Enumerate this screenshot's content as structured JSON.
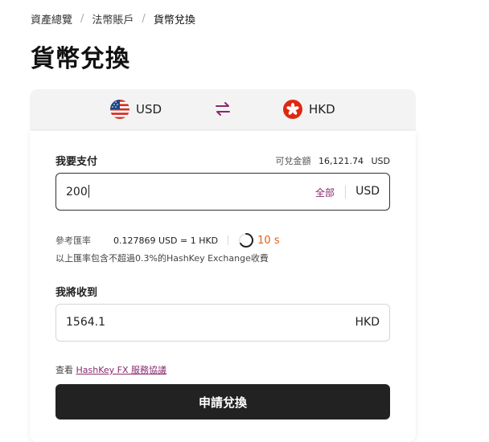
{
  "breadcrumb": {
    "items": [
      "資產總覽",
      "法幣賬戶",
      "貨幣兌換"
    ],
    "separator": "/"
  },
  "page": {
    "title": "貨幣兌換"
  },
  "currency_bar": {
    "from": {
      "code": "USD",
      "flag_icon": "us-flag-icon"
    },
    "to": {
      "code": "HKD",
      "flag_icon": "hk-flag-icon"
    },
    "swap_icon": "swap-arrows-icon"
  },
  "pay": {
    "label": "我要支付",
    "available_label": "可兌金額",
    "available_amount": "16,121.74",
    "available_currency": "USD",
    "value": "200",
    "all_label": "全部",
    "currency": "USD"
  },
  "rate": {
    "label": "參考匯率",
    "value": "0.127869  USD = 1 HKD",
    "countdown": "10 s",
    "note": "以上匯率包含不超過0.3%的HashKey Exchange收費"
  },
  "receive": {
    "label": "我將收到",
    "value": "1564.1",
    "currency": "HKD"
  },
  "terms": {
    "prefix": "查看 ",
    "link": "HashKey FX 服務協議"
  },
  "submit": {
    "label": "申請兌換"
  },
  "colors": {
    "accent": "#8a2a6e",
    "countdown": "#e06317",
    "button": "#222222",
    "bar": "#f3f3f3"
  }
}
